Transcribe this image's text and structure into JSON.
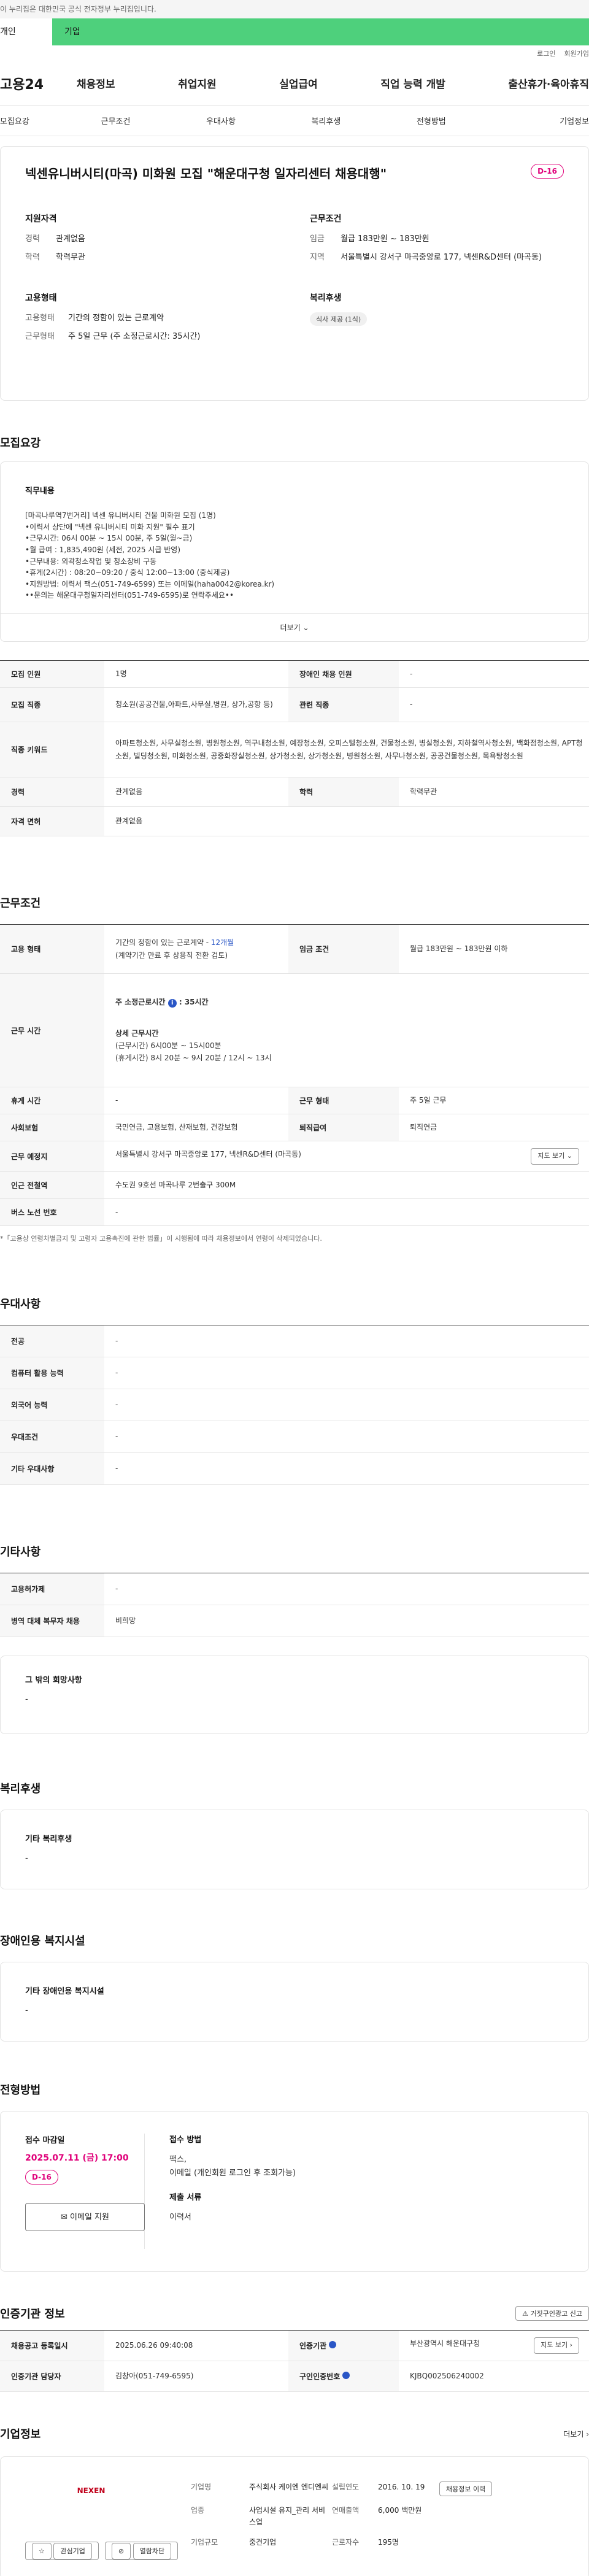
{
  "gov_banner": "이 누리집은 대한민국 공식 전자정부 누리집입니다.",
  "top_tabs": [
    "개인",
    "기업"
  ],
  "util_links": [
    "로그인",
    "회원가입"
  ],
  "brand": "고용24",
  "main_nav": [
    "채용정보",
    "취업지원",
    "실업급여",
    "직업 능력 개발",
    "출산휴가·육아휴직"
  ],
  "sub_nav": [
    "모집요강",
    "근무조건",
    "우대사항",
    "복리후생",
    "전형방법",
    "기업정보"
  ],
  "summary": {
    "title": "넥센유니버시티(마곡) 미화원 모집 \"해운대구청 일자리센터 채용대행\"",
    "dday": "D-16",
    "qual": {
      "heading": "지원자격",
      "career_k": "경력",
      "career_v": "관계없음",
      "edu_k": "학력",
      "edu_v": "학력무관"
    },
    "cond": {
      "heading": "근무조건",
      "wage_k": "임금",
      "wage_v": "월급 183만원 ~ 183만원",
      "loc_k": "지역",
      "loc_v": "서울특별시 강서구 마곡중앙로 177, 넥센R&D센터 (마곡동)"
    },
    "emp": {
      "heading": "고용형태",
      "type_k": "고용형태",
      "type_v": "기간의 정함이 있는 근로계약",
      "work_k": "근무형태",
      "work_v": "주 5일 근무 (주 소정근로시간: 35시간)"
    },
    "welfare": {
      "heading": "복리후생",
      "chip": "식사 제공 (1식)"
    }
  },
  "recruit": {
    "title": "모집요강",
    "desc_heading": "직무내용",
    "desc_lines": [
      "[마곡나루역7번거리] 넥센 유니버시티 건물 미화원 모집 (1명)",
      "•이력서 상단에 \"넥센 유니버시티 미화 지원\" 필수 표기",
      "•근무시간: 06시 00분 ~ 15시 00분, 주 5일(월~금)",
      "•월 급여 : 1,835,490원 (세전, 2025 시급 반영)",
      "•근무내용: 외곽청소작업 및 청소장비 구동",
      "•휴게(2시간) : 08:20~09:20 / 중식 12:00~13:00 (중식제공)",
      "•지원방법: 이력서 팩스(051-749-6599) 또는 이메일(haha0042@korea.kr)",
      "••문의는 해운대구청일자리센터(051-749-6595)로 연락주세요••"
    ],
    "more": "더보기",
    "rows": {
      "count_k": "모집 인원",
      "count_v": "1명",
      "disabled_k": "장애인 채용 인원",
      "disabled_v": "-",
      "job_k": "모집 직종",
      "job_v": "청소원(공공건물,아파트,사무실,병원, 상가,공항 등)",
      "rel_k": "관련 직종",
      "rel_v": "-",
      "kw_k": "직종 키워드",
      "kw_v": "아파트청소원, 사무실청소원, 병원청소원, 역구내청소원, 예장청소원, 오피스텔청소원, 건물청소원, 병실청소원, 지하철역사청소원, 백화점청소원, APT청소원, 빌딩청소원, 미화청소원, 공중화장실청소원, 상가청소원, 상가청소원, 병원청소원, 사무나청소원, 공공건물청소원, 목욕탕청소원",
      "career_k": "경력",
      "career_v": "관계없음",
      "edu_k": "학력",
      "edu_v": "학력무관",
      "cert_k": "자격 면허",
      "cert_v": "관계없음"
    }
  },
  "work": {
    "title": "근무조건",
    "type_k": "고용 형태",
    "type_v1": "기간의 정함이 있는 근로계약 -",
    "type_v1b": "12개월",
    "type_v2": "(계약기간 만료 후 상용직 전환 검토)",
    "wage_k": "임금 조건",
    "wage_v": "월급 183만원 ~ 183만원 이하",
    "hours_k": "근무 시간",
    "hours_main": "주 소정근로시간",
    "hours_badge": "i",
    "hours_main2": ": 35시간",
    "hours_detail_h": "상세 근무시간",
    "hours_detail1": "(근무시간) 6시00분 ~ 15시00분",
    "hours_detail2": "(휴게시간) 8시 20분 ~ 9시 20분 / 12시 ~ 13시",
    "rest_k": "휴게 시간",
    "rest_v": "-",
    "shift_k": "근무 형태",
    "shift_v": "주 5일 근무",
    "ins_k": "사회보험",
    "ins_v": "국민연금, 고용보험, 산재보험, 건강보험",
    "sev_k": "퇴직급여",
    "sev_v": "퇴직연금",
    "place_k": "근무 예정지",
    "place_v": "서울특별시 강서구 마곡중앙로 177, 넥센R&D센터 (마곡동)",
    "map_btn": "지도 보기",
    "subway_k": "인근 전철역",
    "subway_v": "수도권 9호선 마곡나루 2번출구 300M",
    "bus_k": "버스 노선 번호",
    "bus_v": "-",
    "note": "*「고용상 연령차별금지 및 고령자 고용촉진에 관한 법률」이 시행됨에 따라 채용정보에서 연령이 삭제되었습니다."
  },
  "pref": {
    "title": "우대사항",
    "rows": [
      {
        "k": "전공",
        "v": "-"
      },
      {
        "k": "컴퓨터 활용 능력",
        "v": "-"
      },
      {
        "k": "외국어 능력",
        "v": "-"
      },
      {
        "k": "우대조건",
        "v": "-"
      },
      {
        "k": "기타 우대사항",
        "v": "-"
      }
    ]
  },
  "etc": {
    "title": "기타사항",
    "rows": [
      {
        "k": "고용허가제",
        "v": "-"
      },
      {
        "k": "병역 대체 복무자 채용",
        "v": "비희망"
      }
    ],
    "box_h": "그 밖의 희망사항",
    "box_v": "-"
  },
  "welfare": {
    "title": "복리후생",
    "box_h": "기타 복리후생",
    "box_v": "-"
  },
  "disabled": {
    "title": "장애인용 복지시설",
    "box_h": "기타 장애인용 복지시설",
    "box_v": "-"
  },
  "apply": {
    "title": "전형방법",
    "deadline_h": "접수 마감일",
    "deadline": "2025.07.11 (금) 17:00",
    "dday": "D-16",
    "email_btn": "이메일 지원",
    "method_h": "접수 방법",
    "method_v1": "팩스,",
    "method_v2": "이메일 (개인회원 로그인 후 조회가능)",
    "docs_h": "제출 서류",
    "docs_v": "이력서"
  },
  "cert": {
    "title": "인증기관 정보",
    "report_btn": "거짓구인광고 신고",
    "reg_k": "채용공고 등록일시",
    "reg_v": "2025.06.26 09:40:08",
    "org_k": "인증기관",
    "org_v": "부산광역시 해운대구청",
    "map_btn": "지도 보기",
    "mgr_k": "인증기관 담당자",
    "mgr_v": "김창아(051-749-6595)",
    "no_k": "구인인증번호",
    "no_v": "KJBQ002506240002"
  },
  "company": {
    "title": "기업정보",
    "more": "더보기",
    "logo_text": "NEXEN",
    "fav_btn": "관심기업",
    "block_btn": "열람차단",
    "name_k": "기업명",
    "name_v": "주식회사 케이엔 엔디엔씨",
    "year_k": "설립연도",
    "year_v": "2016. 10. 19",
    "jobs_btn": "채용정보 이력",
    "biz_k": "업종",
    "biz_v": "사업시설 유지_관리 서비스업",
    "rev_k": "연매출액",
    "rev_v": "6,000 백만원",
    "emp_k": "근로자수",
    "emp_v": "195명",
    "scale_k": "기업규모",
    "scale_v": "중견기업"
  },
  "colors": {
    "accent": "#4ed07c",
    "dday": "#e0007a",
    "link": "#2a56c6"
  }
}
